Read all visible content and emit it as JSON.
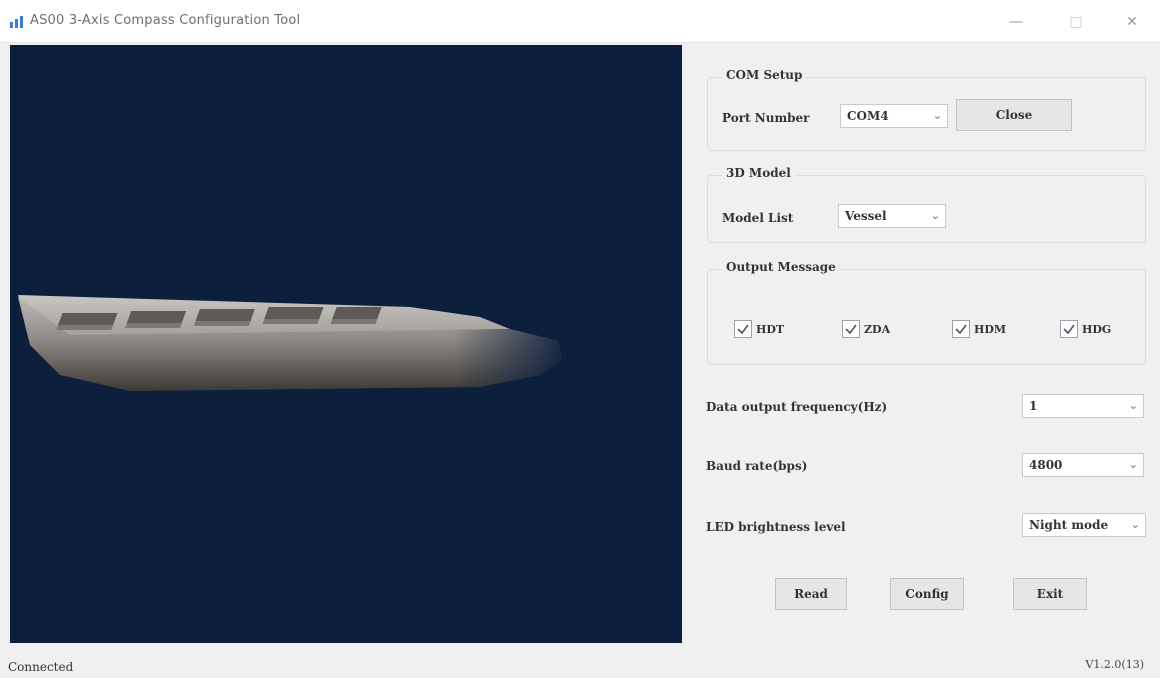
{
  "window": {
    "title": "AS00 3-Axis Compass Configuration Tool",
    "minimize": "—",
    "maximize": "□",
    "close": "✕"
  },
  "com_setup": {
    "title": "COM Setup",
    "port_label": "Port Number",
    "port_value": "COM4",
    "close_button": "Close"
  },
  "model_3d": {
    "title": "3D Model",
    "list_label": "Model List",
    "list_value": "Vessel"
  },
  "output_message": {
    "title": "Output Message",
    "items": [
      {
        "label": "HDT",
        "checked": true
      },
      {
        "label": "ZDA",
        "checked": true
      },
      {
        "label": "HDM",
        "checked": true
      },
      {
        "label": "HDG",
        "checked": true
      }
    ]
  },
  "settings": {
    "frequency_label": "Data output frequency(Hz)",
    "frequency_value": "1",
    "baud_label": "Baud rate(bps)",
    "baud_value": "4800",
    "led_label": "LED brightness level",
    "led_value": "Night mode"
  },
  "actions": {
    "read": "Read",
    "config": "Config",
    "exit": "Exit"
  },
  "status": {
    "connection": "Connected",
    "version": "V1.2.0(13)"
  },
  "colors": {
    "viewport_background": "#0c1f3d",
    "hull": "#8d8a86"
  }
}
